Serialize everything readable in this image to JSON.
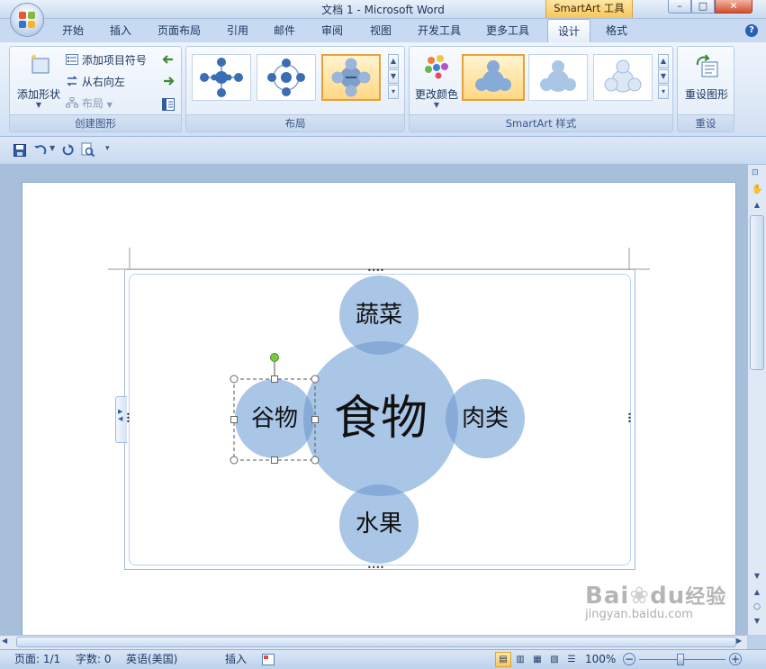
{
  "window": {
    "title": "文档 1 - Microsoft Word",
    "contextual_tab_header": "SmartArt 工具",
    "min_label": "–",
    "max_label": "□",
    "close_label": "✕"
  },
  "tabs": [
    {
      "label": "开始"
    },
    {
      "label": "插入"
    },
    {
      "label": "页面布局"
    },
    {
      "label": "引用"
    },
    {
      "label": "邮件"
    },
    {
      "label": "审阅"
    },
    {
      "label": "视图"
    },
    {
      "label": "开发工具"
    },
    {
      "label": "更多工具"
    },
    {
      "label": "设计",
      "active": true
    },
    {
      "label": "格式"
    }
  ],
  "ribbon": {
    "create_graphic": {
      "label": "创建图形",
      "add_shape": "添加形状",
      "add_bullet": "添加项目符号",
      "right_to_left": "从右向左",
      "layout": "布局"
    },
    "layouts": {
      "label": "布局"
    },
    "smartart_styles": {
      "label": "SmartArt 样式",
      "change_colors": "更改颜色"
    },
    "reset": {
      "label": "重设",
      "reset_graphic": "重设图形"
    }
  },
  "diagram": {
    "center": "食物",
    "top": "蔬菜",
    "right": "肉类",
    "bottom": "水果",
    "left": "谷物",
    "fill_color": "#a9c6e7",
    "overlap_color": "#87abd8"
  },
  "status": {
    "page": "页面: 1/1",
    "words": "字数: 0",
    "language": "英语(美国)",
    "insert_mode": "插入",
    "zoom": "100%"
  },
  "watermark": {
    "brand_a": "Bai",
    "brand_b": "du",
    "brand_c": "经验",
    "url": "jingyan.baidu.com"
  }
}
